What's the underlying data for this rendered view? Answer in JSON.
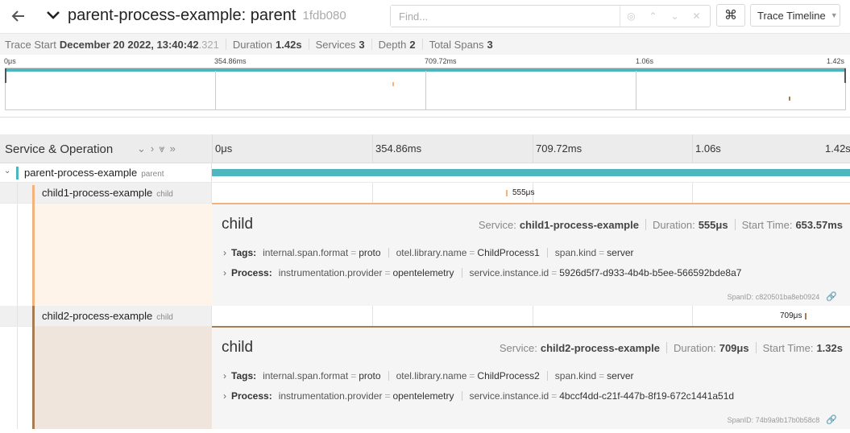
{
  "header": {
    "title": "parent-process-example: parent",
    "trace_id": "1fdb080",
    "find_placeholder": "Find...",
    "keyboard_icon": "⌘",
    "view_select": "Trace Timeline"
  },
  "summary": {
    "trace_start_label": "Trace Start",
    "trace_start_value": "December 20 2022, 13:40:42",
    "trace_start_ms": ".321",
    "duration_label": "Duration",
    "duration_value": "1.42s",
    "services_label": "Services",
    "services_value": "3",
    "depth_label": "Depth",
    "depth_value": "2",
    "spans_label": "Total Spans",
    "spans_value": "3"
  },
  "ticks": [
    "0μs",
    "354.86ms",
    "709.72ms",
    "1.06s",
    "1.42s"
  ],
  "timeline_header": {
    "label": "Service & Operation"
  },
  "spans": [
    {
      "service": "parent-process-example",
      "operation": "parent",
      "color": "#4eb6bf",
      "start": 0.0,
      "end": 1.0,
      "duration": ""
    },
    {
      "service": "child1-process-example",
      "operation": "child",
      "color": "#f4b27c",
      "start": 0.4605,
      "end": 0.4609,
      "duration": "555μs"
    },
    {
      "service": "child2-process-example",
      "operation": "child",
      "color": "#a67c52",
      "start": 0.9294,
      "end": 0.9299,
      "duration": "709μs"
    }
  ],
  "details": [
    {
      "title": "child",
      "service_label": "Service:",
      "service": "child1-process-example",
      "duration_label": "Duration:",
      "duration": "555μs",
      "start_label": "Start Time:",
      "start": "653.57ms",
      "tags_label": "Tags:",
      "tags": [
        {
          "k": "internal.span.format",
          "v": "proto"
        },
        {
          "k": "otel.library.name",
          "v": "ChildProcess1"
        },
        {
          "k": "span.kind",
          "v": "server"
        }
      ],
      "process_label": "Process:",
      "process": [
        {
          "k": "instrumentation.provider",
          "v": "opentelemetry"
        },
        {
          "k": "service.instance.id",
          "v": "5926d5f7-d933-4b4b-b5ee-566592bde8a7"
        }
      ],
      "span_id_label": "SpanID:",
      "span_id": "c820501ba8eb0924"
    },
    {
      "title": "child",
      "service_label": "Service:",
      "service": "child2-process-example",
      "duration_label": "Duration:",
      "duration": "709μs",
      "start_label": "Start Time:",
      "start": "1.32s",
      "tags_label": "Tags:",
      "tags": [
        {
          "k": "internal.span.format",
          "v": "proto"
        },
        {
          "k": "otel.library.name",
          "v": "ChildProcess2"
        },
        {
          "k": "span.kind",
          "v": "server"
        }
      ],
      "process_label": "Process:",
      "process": [
        {
          "k": "instrumentation.provider",
          "v": "opentelemetry"
        },
        {
          "k": "service.instance.id",
          "v": "4bccf4dd-c21f-447b-8f19-672c1441a51d"
        }
      ],
      "span_id_label": "SpanID:",
      "span_id": "74b9a9b17b0b58c8"
    }
  ]
}
